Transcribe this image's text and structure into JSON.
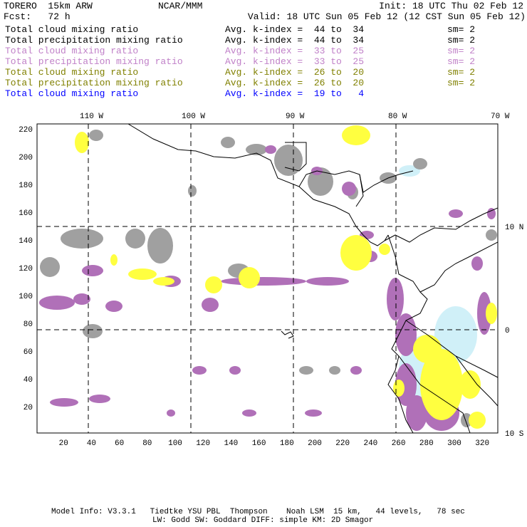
{
  "header": {
    "model": "TORERO  15km ARW",
    "org": "NCAR/MMM",
    "init": "Init: 18 UTC Thu 02 Feb 12",
    "fcst": "Fcst:   72 h",
    "valid": "Valid: 18 UTC Sun 05 Feb 12 (12 CST Sun 05 Feb 12)"
  },
  "legend": [
    {
      "field": "Total cloud mixing ratio",
      "range": "Avg. k-index =  44 to  34",
      "sm": "sm= 2",
      "color": "#000000"
    },
    {
      "field": "Total precipitation mixing ratio",
      "range": "Avg. k-index =  44 to  34",
      "sm": "sm= 2",
      "color": "#000000"
    },
    {
      "field": "Total cloud mixing ratio",
      "range": "Avg. k-index =  33 to  25",
      "sm": "sm= 2",
      "color": "#c080c8"
    },
    {
      "field": "Total precipitation mixing ratio",
      "range": "Avg. k-index =  33 to  25",
      "sm": "sm= 2",
      "color": "#c080c8"
    },
    {
      "field": "Total cloud mixing ratio",
      "range": "Avg. k-index =  26 to  20",
      "sm": "sm= 2",
      "color": "#808000"
    },
    {
      "field": "Total precipitation mixing ratio",
      "range": "Avg. k-index =  26 to  20",
      "sm": "sm= 2",
      "color": "#808000"
    },
    {
      "field": "Total cloud mixing ratio",
      "range": "Avg. k-index =  19 to   4",
      "color": "#0000ff"
    }
  ],
  "map": {
    "lon_labels": [
      "110 W",
      "100 W",
      "90 W",
      "80 W",
      "70 W"
    ],
    "lat_labels": [
      "10 N",
      "0",
      "10 S"
    ],
    "x_ticks": [
      "20",
      "40",
      "60",
      "80",
      "100",
      "120",
      "140",
      "160",
      "180",
      "200",
      "220",
      "240",
      "260",
      "280",
      "300",
      "320"
    ],
    "y_ticks": [
      "20",
      "40",
      "60",
      "80",
      "100",
      "120",
      "140",
      "160",
      "180",
      "200",
      "220"
    ],
    "fill_colors": {
      "high": "#a0a0a0",
      "mid": "#b070b8",
      "low": "#ffff40",
      "top": "#d0f0f8"
    }
  },
  "footer": {
    "line1": "Model Info: V3.3.1   Tiedtke YSU PBL  Thompson    Noah LSM  15 km,   44 levels,   78 sec",
    "line2": "LW: Godd SW: Goddard DIFF: simple KM: 2D Smagor"
  }
}
